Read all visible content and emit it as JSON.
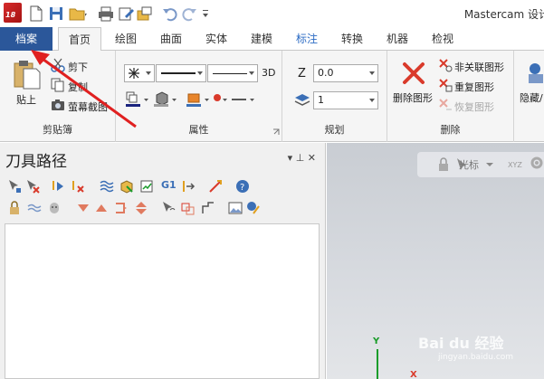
{
  "title_bar": {
    "app_version": "18",
    "window_title": "Mastercam 设计"
  },
  "tabs": {
    "file": "档案",
    "items": [
      "首页",
      "绘图",
      "曲面",
      "实体",
      "建模",
      "标注",
      "转换",
      "机器",
      "检视"
    ],
    "active": "首页"
  },
  "ribbon": {
    "clipboard": {
      "paste": "贴上",
      "cut": "剪下",
      "copy": "复制",
      "screenshot": "萤幕截图",
      "label": "剪贴簿"
    },
    "attributes": {
      "label": "属性",
      "mode_3d": "3D"
    },
    "planning": {
      "z_label": "Z",
      "z_value": "0.0",
      "level_value": "1",
      "label": "规划"
    },
    "delete": {
      "delete_entities": "删除图形",
      "unassociate": "非关联图形",
      "duplicate": "重复图形",
      "restore": "恢复图形",
      "label": "删除"
    },
    "display": {
      "hide": "隐藏/"
    }
  },
  "panel": {
    "title": "刀具路径",
    "controls": "▾  ⊥  ✕",
    "g1_label": "G1"
  },
  "viewport": {
    "cursor_label": "光标",
    "axis_x": "X",
    "axis_y": "Y",
    "coord_label": "XYZ"
  },
  "watermark": {
    "text": "Bai du 经验",
    "sub": "jingyan.baidu.com"
  },
  "colors": {
    "file_tab": "#2b579a",
    "accent_red": "#d93a2b",
    "axis_green": "#1a9c2a"
  }
}
